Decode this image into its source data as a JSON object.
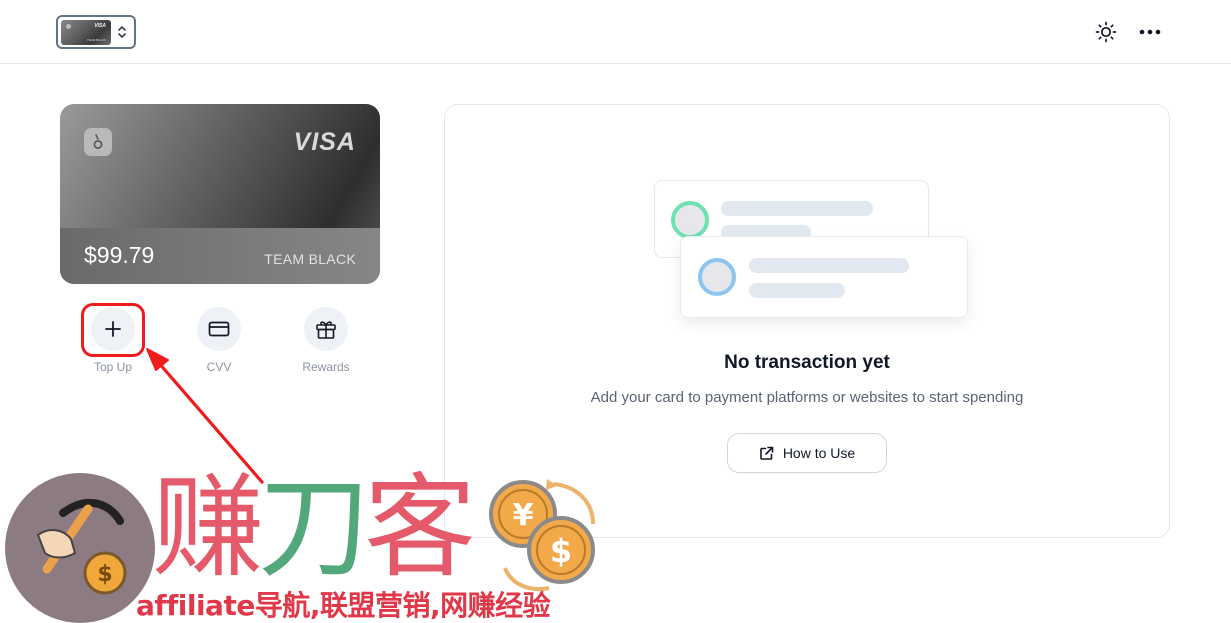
{
  "header": {
    "card_switcher": {
      "mini_card_brand": "VISA",
      "mini_card_text": "TEAM BLACK"
    },
    "icons": [
      "sun-icon",
      "more-horizontal-icon"
    ]
  },
  "card": {
    "brand": "VISA",
    "balance": "$99.79",
    "name": "TEAM BLACK",
    "logo_icon": "keyhole-logo-icon"
  },
  "actions": [
    {
      "label": "Top Up",
      "icon": "plus-icon"
    },
    {
      "label": "CVV",
      "icon": "credit-card-icon"
    },
    {
      "label": "Rewards",
      "icon": "gift-icon"
    }
  ],
  "empty_state": {
    "title": "No transaction yet",
    "subtitle": "Add your card to payment platforms or websites to start spending",
    "button_label": "How to Use",
    "button_icon": "external-link-icon"
  },
  "annotation": {
    "color": "#ee1c1c"
  },
  "watermark": {
    "big_text_1": "赚",
    "big_text_2": "刀",
    "big_text_3": "客",
    "caption": "affiliate导航,联盟营销,网赚经验",
    "coin_symbols": [
      "¥",
      "$"
    ]
  },
  "colors": {
    "ring_green": "#6fe0b0",
    "ring_blue": "#8ec5f0",
    "watermark_red": "#e45a6a",
    "watermark_green": "#52a87a"
  }
}
